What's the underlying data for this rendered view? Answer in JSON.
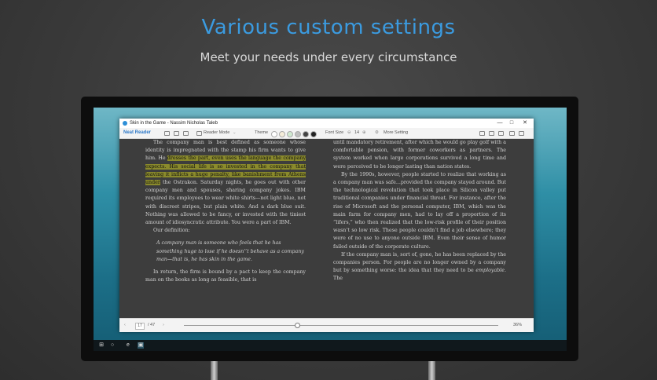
{
  "headline": "Various custom settings",
  "subline": "Meet your needs under every circumstance",
  "window": {
    "title": "Skin in the Game - Nassim Nicholas Taleb",
    "controls": {
      "minimize": "—",
      "maximize": "□",
      "close": "✕"
    }
  },
  "toolbar": {
    "brand": "Neat Reader",
    "reader_mode": "Reader Mode",
    "theme_label": "Theme",
    "font_size_label": "Font Size",
    "font_size_value": "14",
    "more_setting": "More Setting",
    "theme_colors": [
      "#ffffff",
      "#f4ecd8",
      "#cfe8cf",
      "#bdbdbd",
      "#444444",
      "#222222"
    ]
  },
  "left_page": {
    "p1_a": "The company man is best defined as someone whose identity is impregnated with the stamp his firm wants to give him. He ",
    "p1_hl": "dresses the part, even uses the language the company expects. His social life is so invested in the company that leaving it inflicts a huge penalty, like banishment from Athens under",
    "p1_b": " the Ostrakon. Saturday nights, he goes out with other company men and spouses, sharing company jokes. IBM required its employees to wear white shirts—not light blue, not with discreet stripes, but plain white. And a dark blue suit. Nothing was allowed to be fancy, or invested with the tiniest amount of idiosyncratic attribute. You were a part of IBM.",
    "p2": "Our definition:",
    "quote": "A company man is someone who feels that he has something huge to lose if he doesn'’t behave as a company man—that is, he has skin in the game.",
    "p3": "In return, the firm is bound by a pact to keep the company man on the books as long as feasible, that is"
  },
  "right_page": {
    "p1": "until mandatory retirement, after which he would go play golf with a comfortable pension, with former coworkers as partners. The system worked when large corporations survived a long time and were perceived to be longer lasting than nation states.",
    "p2": "By the 1990s, however, people started to realize that working as a company man was safe...provided the company stayed around. But the technological revolution that took place in Silicon valley put traditional companies under financial threat. For instance, after the rise of Microsoft and the personal computer, IBM, which was the main farm for company men, had to lay off a proportion of its “lifers,” who then realized that the low-risk profile of their position wasn’t so low risk. These people couldn’t find a job elsewhere; they were of no use to anyone outside IBM. Even their sense of humor failed outside of the corporate culture.",
    "p3_a": "If the company man is, sort of, gone, he has been replaced by the companies person. For people are no longer owned by a company but by something worse: the idea that they need to be ",
    "p3_em": "employable",
    "p3_b": ". The"
  },
  "bottombar": {
    "page_current": "17",
    "page_total": "/ 47",
    "progress_label": "36%",
    "progress_value": 0.36
  }
}
